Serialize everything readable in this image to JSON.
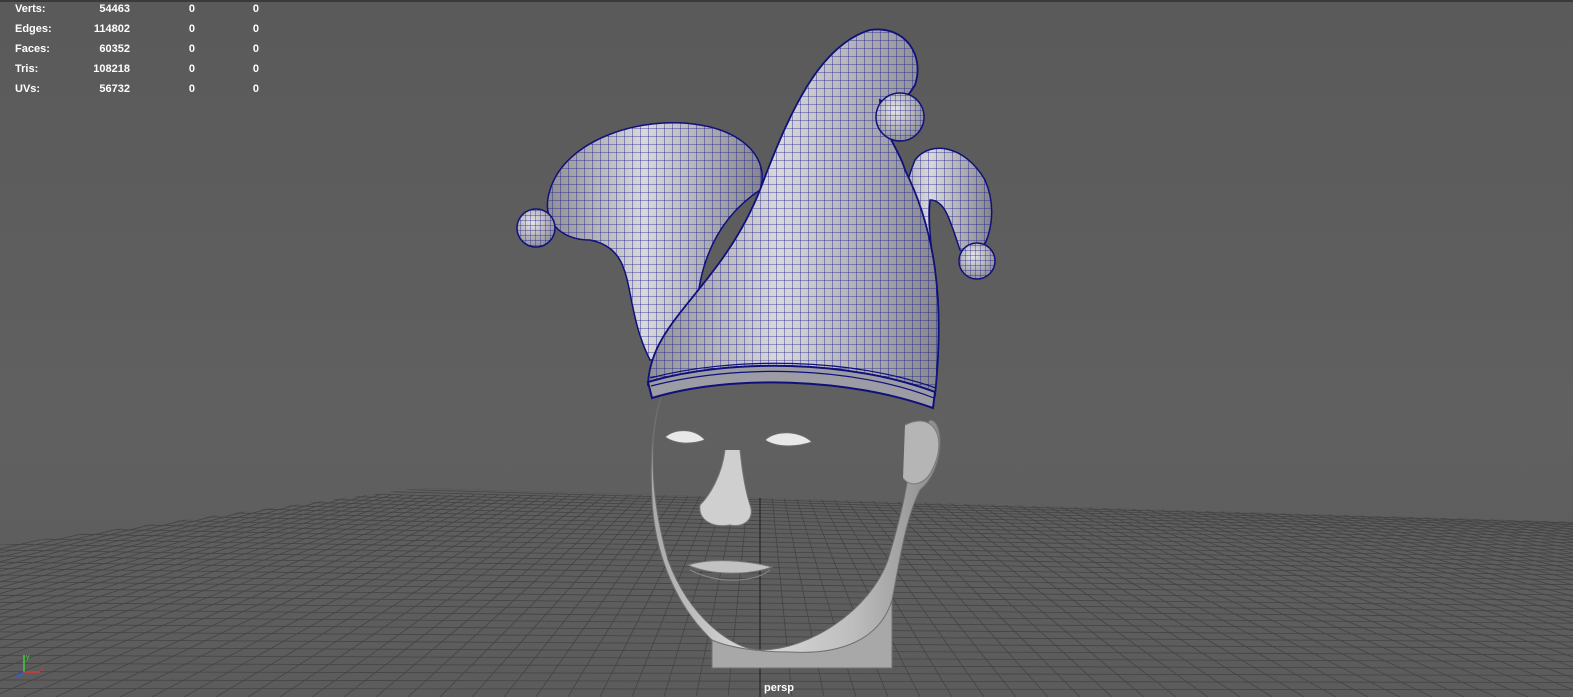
{
  "hud": {
    "rows": [
      {
        "label": "Verts:",
        "v1": "54463",
        "v2": "0",
        "v3": "0"
      },
      {
        "label": "Edges:",
        "v1": "114802",
        "v2": "0",
        "v3": "0"
      },
      {
        "label": "Faces:",
        "v1": "60352",
        "v2": "0",
        "v3": "0"
      },
      {
        "label": "Tris:",
        "v1": "108218",
        "v2": "0",
        "v3": "0"
      },
      {
        "label": "UVs:",
        "v1": "56732",
        "v2": "0",
        "v3": "0"
      }
    ]
  },
  "camera": {
    "label": "persp"
  },
  "colors": {
    "viewport_bg": "#5e5e5e",
    "grid_line": "#444444",
    "grid_axis": "#2f2f2f",
    "wireframe": "#14148c",
    "mesh_shade": "#c8c8c8",
    "hud_text": "#ffffff"
  },
  "icons": {
    "axis_gizmo": "xyz-axis-icon"
  }
}
